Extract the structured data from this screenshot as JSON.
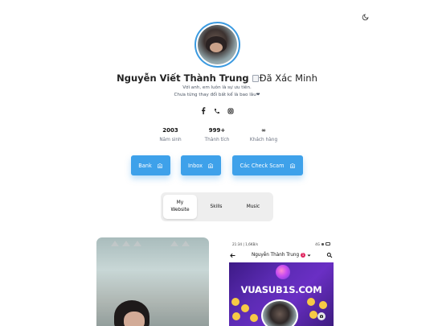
{
  "header": {
    "theme_toggle_icon": "moon-icon"
  },
  "profile": {
    "name": "Nguyễn Viết Thành Trung",
    "verified_alt": "Đã Xác Minh",
    "bio_line1": "Với anh, em luôn là sự ưu tiên.",
    "bio_line2": "Chưa từng thay đổi bất kể là bao lâu❤"
  },
  "socials": [
    {
      "icon": "facebook-icon"
    },
    {
      "icon": "phone-icon"
    },
    {
      "icon": "instagram-icon"
    }
  ],
  "stats": [
    {
      "value": "2003",
      "label": "Năm sinh"
    },
    {
      "value": "999+",
      "label": "Thành tích"
    },
    {
      "value": "∞",
      "label": "Khách hàng"
    }
  ],
  "actions": [
    {
      "label": "Bank",
      "icon": "bank-icon"
    },
    {
      "label": "Inbox",
      "icon": "bank-icon"
    },
    {
      "label": "Các Check Scam",
      "icon": "bank-icon"
    }
  ],
  "tabs": [
    {
      "label_line1": "My",
      "label_line2": "Website",
      "active": true
    },
    {
      "label": "Skills",
      "active": false
    },
    {
      "label": "Music",
      "active": false
    }
  ],
  "phone_preview": {
    "status_time": "21:34 | 1,6KB/s",
    "status_right": "4G",
    "title": "Nguyễn Thành Trung",
    "badge": "1",
    "cover_text": "VUASUB1S.COM"
  },
  "colors": {
    "accent": "#3ea1ea",
    "tab_bg": "#eeeeee",
    "cover": "#5b2bb3"
  }
}
